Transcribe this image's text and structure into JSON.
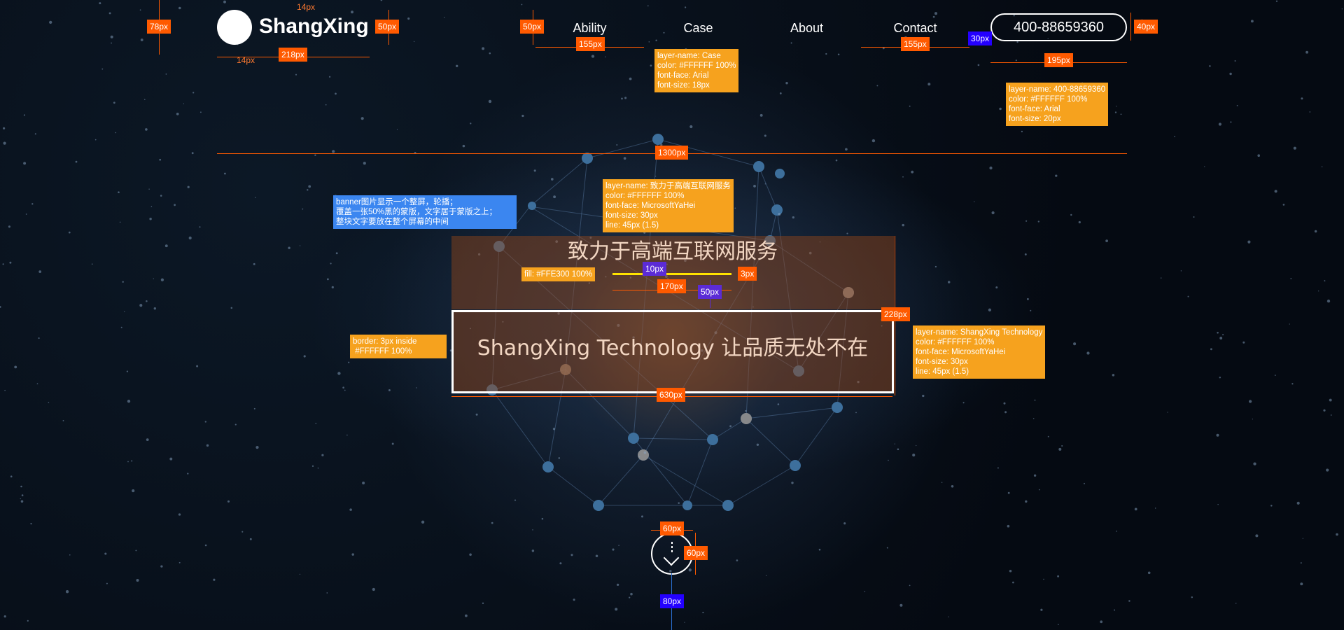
{
  "header": {
    "brand": "ShangXing",
    "nav": [
      "Ability",
      "Case",
      "About",
      "Contact"
    ],
    "phone": "400-88659360"
  },
  "banner": {
    "headline": "致力于高端互联网服务",
    "subline": "ShangXing Technology  让品质无处不在",
    "accent_color": "#FFE300"
  },
  "annotations": {
    "tags": [
      {
        "id": "logo-height",
        "text": "78px"
      },
      {
        "id": "top-14",
        "text": "14px"
      },
      {
        "id": "logo-14",
        "text": "14px"
      },
      {
        "id": "logo-width",
        "text": "218px"
      },
      {
        "id": "logo-50",
        "text": "50px"
      },
      {
        "id": "nav-50",
        "text": "50px"
      },
      {
        "id": "nav-155-a",
        "text": "155px"
      },
      {
        "id": "nav-155-b",
        "text": "155px"
      },
      {
        "id": "gap-30",
        "text": "30px"
      },
      {
        "id": "phone-40",
        "text": "40px"
      },
      {
        "id": "phone-195",
        "text": "195px"
      },
      {
        "id": "content-1300",
        "text": "1300px"
      },
      {
        "id": "gap-10",
        "text": "10px"
      },
      {
        "id": "line-3",
        "text": "3px"
      },
      {
        "id": "line-170",
        "text": "170px"
      },
      {
        "id": "gap-50",
        "text": "50px"
      },
      {
        "id": "box-228",
        "text": "228px"
      },
      {
        "id": "box-630",
        "text": "630px"
      },
      {
        "id": "scroll-60w",
        "text": "60px"
      },
      {
        "id": "scroll-60h",
        "text": "60px"
      },
      {
        "id": "line-80",
        "text": "80px"
      }
    ],
    "notes": {
      "case": "layer-name: Case\ncolor: #FFFFFF 100%\nfont-face: Arial\nfont-size: 18px",
      "phone": "layer-name: 400-88659360\ncolor: #FFFFFF 100%\nfont-face: Arial\nfont-size: 20px",
      "headline": "layer-name: 致力于高端互联网服务\ncolor: #FFFFFF 100%\nfont-face: MicrosoftYaHei\nfont-size: 30px\nline: 45px (1.5)",
      "banner_desc": "banner图片显示一个整屏，轮播；\n覆盖一张50%黑的蒙版，文字居于蒙版之上；\n整块文字要放在整个屏幕的中间",
      "fill": "fill: #FFE300 100%",
      "border": "border: 3px inside\n #FFFFFF 100%",
      "subline": "layer-name: ShangXing Technology\ncolor: #FFFFFF 100%\nfont-face: MicrosoftYaHei\nfont-size: 30px\nline: 45px (1.5)"
    }
  }
}
